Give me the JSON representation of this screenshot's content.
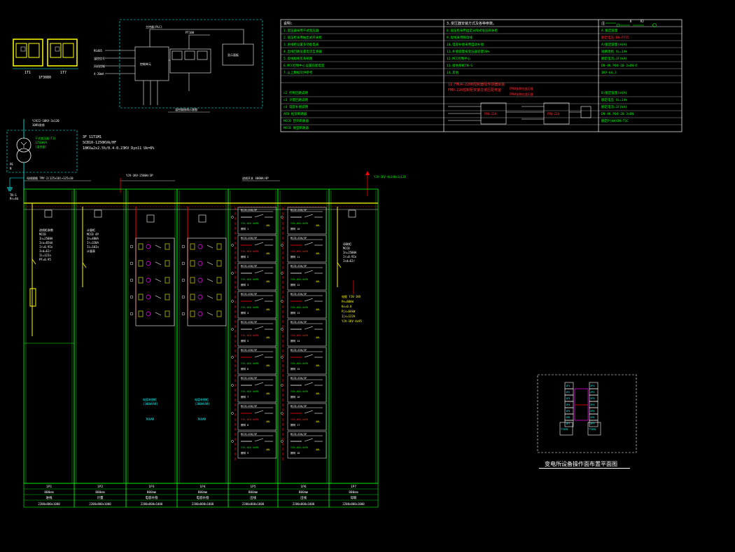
{
  "drawing": {
    "layout_caption": "变电所设备操作面布置平面图",
    "transformer": {
      "text_lines": [
        "3F 11T1M1",
        "SCB10-1250KVA/HF",
        "10KV±2x2.5%/0.4-0.23KV Dyn11 Uk=6%"
      ]
    },
    "panels": [
      {
        "number": "1P1",
        "width": "800mm",
        "use": "进线"
      },
      {
        "number": "1P2",
        "width": "800mm",
        "use": "计量"
      },
      {
        "number": "1P3",
        "width": "800mm",
        "use": "电容补偿"
      },
      {
        "number": "1P4",
        "width": "800mm",
        "use": "电容补偿"
      },
      {
        "number": "1P5",
        "width": "800mm",
        "use": "出线"
      },
      {
        "number": "1P6",
        "width": "800mm",
        "use": "出线"
      },
      {
        "number": "1P7",
        "width": "800mm",
        "use": "母联"
      }
    ],
    "layout_cells_left": [
      "1P1",
      "1P2",
      "1P3",
      "1P4",
      "1P5",
      "1P6",
      "1P7"
    ],
    "layout_cells_right": [
      "2P1",
      "2P2",
      "2P3",
      "2P4",
      "2P5",
      "2P6",
      "2P7"
    ],
    "layout_bottom": [
      "TT1M1",
      "TT1M2"
    ],
    "table": {
      "header": [
        "说明:",
        "3.变压器安装方式及各种参数。",
        "注"
      ],
      "rows": [
        [
          "1.变压器采用干式变压器",
          "8.低压柜采用固定分隔式低压开关柜",
          "A.额定容量"
        ],
        [
          "2.低压柜采用抽出式开关柜",
          "9.母线采用铜母线",
          "额定电压:DN-FF55"
        ],
        [
          "3.进线柜设置多功能电表",
          "10.电容补偿采用自动补偿",
          "A)额定容量(kVA)"
        ],
        [
          "4.出线回路设置电流互感器",
          "11.补偿容量按变压器容量30%",
          "短路阻抗 XL=14%"
        ],
        [
          "5.母线规格见系统图",
          "12.MCC控制中心",
          "额定电流=1F(kA)"
        ],
        [
          "6.MCC控制中心设置在配电室",
          "13.接地系统TN-S",
          "DN-4K.P04-20-3+DN-F"
        ],
        [
          "7.以上数据仅供参考",
          "14.其他",
          "IKV-A4.3"
        ]
      ]
    }
  }
}
